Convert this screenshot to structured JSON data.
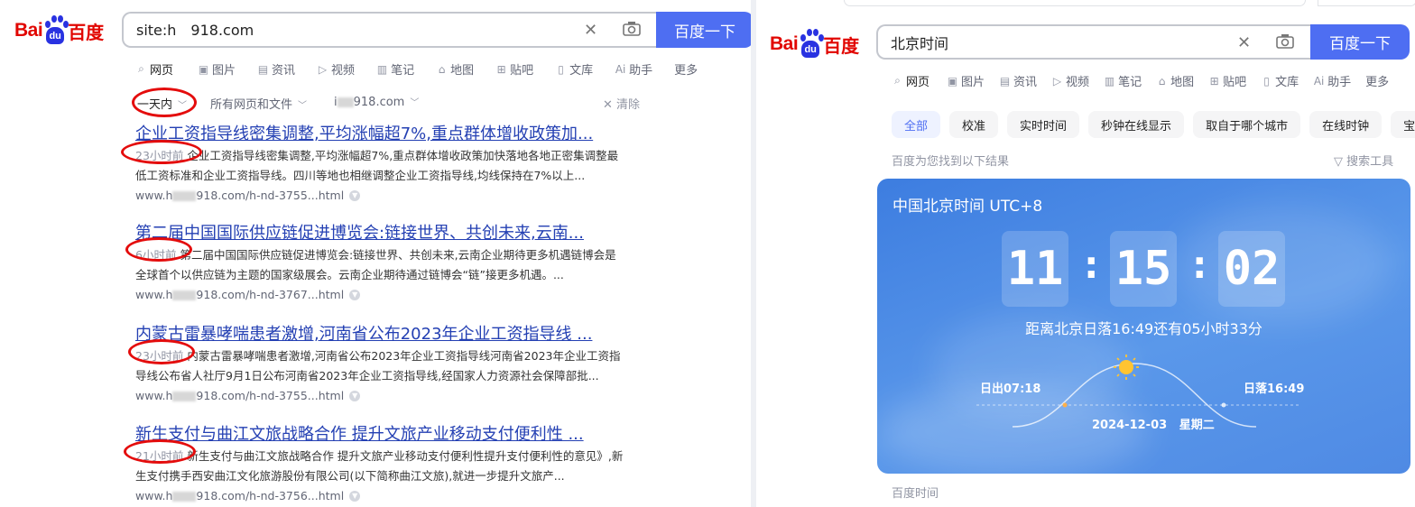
{
  "left": {
    "logo": {
      "bai": "Bai",
      "du": "du",
      "baidu_cn": "百度"
    },
    "search": {
      "query": "site:h 918.com",
      "button": "百度一下"
    },
    "tabs": [
      {
        "icon": "search-icon",
        "glyph": "⌕",
        "label": "网页"
      },
      {
        "icon": "image-icon",
        "glyph": "▣",
        "label": "图片"
      },
      {
        "icon": "news-icon",
        "glyph": "▤",
        "label": "资讯"
      },
      {
        "icon": "video-icon",
        "glyph": "▷",
        "label": "视频"
      },
      {
        "icon": "note-icon",
        "glyph": "▥",
        "label": "笔记"
      },
      {
        "icon": "map-icon",
        "glyph": "⌂",
        "label": "地图"
      },
      {
        "icon": "tieba-icon",
        "glyph": "⊞",
        "label": "贴吧"
      },
      {
        "icon": "library-icon",
        "glyph": "▯",
        "label": "文库"
      },
      {
        "icon": "ai-icon",
        "glyph": "Ai",
        "label": "助手"
      },
      {
        "icon": "",
        "glyph": "",
        "label": "更多"
      }
    ],
    "filters": {
      "time": "一天内",
      "type": "所有网页和文件",
      "site_prefix": "i",
      "site_suffix": "918.com",
      "clear": "清除"
    },
    "results": [
      {
        "title": "企业工资指导线密集调整,平均涨幅超7%,重点群体增收政策加...",
        "time": "23小时前",
        "snippet1": "企业工资指导线密集调整,平均涨幅超7%,重点群体增收政策加快落地各地正密集调整最",
        "snippet2": "低工资标准和企业工资指导线。四川等地也相继调整企业工资指导线,均线保持在7%以上...",
        "url_prefix": "www.h",
        "url_suffix": "918.com/h-nd-3755...html"
      },
      {
        "title": "第二届中国国际供应链促进博览会:链接世界、共创未来,云南...",
        "time": "6小时前",
        "snippet1": "第二届中国国际供应链促进博览会:链接世界、共创未来,云南企业期待更多机遇链博会是",
        "snippet2": "全球首个以供应链为主题的国家级展会。云南企业期待通过链博会“链”接更多机遇。...",
        "url_prefix": "www.h",
        "url_suffix": "918.com/h-nd-3767...html"
      },
      {
        "title": "内蒙古雷暴哮喘患者激增,河南省公布2023年企业工资指导线 ...",
        "time": "23小时前",
        "snippet1": "内蒙古雷暴哮喘患者激增,河南省公布2023年企业工资指导线河南省2023年企业工资指",
        "snippet2": "导线公布省人社厅9月1日公布河南省2023年企业工资指导线,经国家人力资源社会保障部批...",
        "url_prefix": "www.h",
        "url_suffix": "918.com/h-nd-3755...html"
      },
      {
        "title": "新生支付与曲江文旅战略合作 提升文旅产业移动支付便利性 ...",
        "time": "21小时前",
        "snippet1": "新生支付与曲江文旅战略合作 提升文旅产业移动支付便利性提升支付便利性的意见》,新",
        "snippet2": "生支付携手西安曲江文化旅游股份有限公司(以下简称曲江文旅),就进一步提升文旅产...",
        "url_prefix": "www.h",
        "url_suffix": "918.com/h-nd-3756...html"
      }
    ]
  },
  "right": {
    "logo": {
      "bai": "Bai",
      "du": "du",
      "baidu_cn": "百度"
    },
    "search": {
      "query": "北京时间",
      "button": "百度一下"
    },
    "tabs": [
      {
        "icon": "search-icon",
        "glyph": "⌕",
        "label": "网页"
      },
      {
        "icon": "image-icon",
        "glyph": "▣",
        "label": "图片"
      },
      {
        "icon": "news-icon",
        "glyph": "▤",
        "label": "资讯"
      },
      {
        "icon": "video-icon",
        "glyph": "▷",
        "label": "视频"
      },
      {
        "icon": "note-icon",
        "glyph": "▥",
        "label": "笔记"
      },
      {
        "icon": "map-icon",
        "glyph": "⌂",
        "label": "地图"
      },
      {
        "icon": "tieba-icon",
        "glyph": "⊞",
        "label": "贴吧"
      },
      {
        "icon": "library-icon",
        "glyph": "▯",
        "label": "文库"
      },
      {
        "icon": "ai-icon",
        "glyph": "Ai",
        "label": "助手"
      },
      {
        "icon": "",
        "glyph": "",
        "label": "更多"
      }
    ],
    "chips": [
      "全部",
      "校准",
      "实时时间",
      "秒钟在线显示",
      "取自于哪个城市",
      "在线时钟",
      "宝"
    ],
    "result_count": "百度为您找到以下结果",
    "search_tools": "搜索工具",
    "clock": {
      "title": "中国北京时间 UTC+8",
      "digits": [
        "11",
        "15",
        "02"
      ],
      "sunset_note": "距离北京日落16:49还有05小时33分",
      "sunrise": "日出07:18",
      "sunset": "日落16:49",
      "date": "2024-12-03",
      "weekday": "星期二"
    },
    "footer": "百度时间"
  }
}
